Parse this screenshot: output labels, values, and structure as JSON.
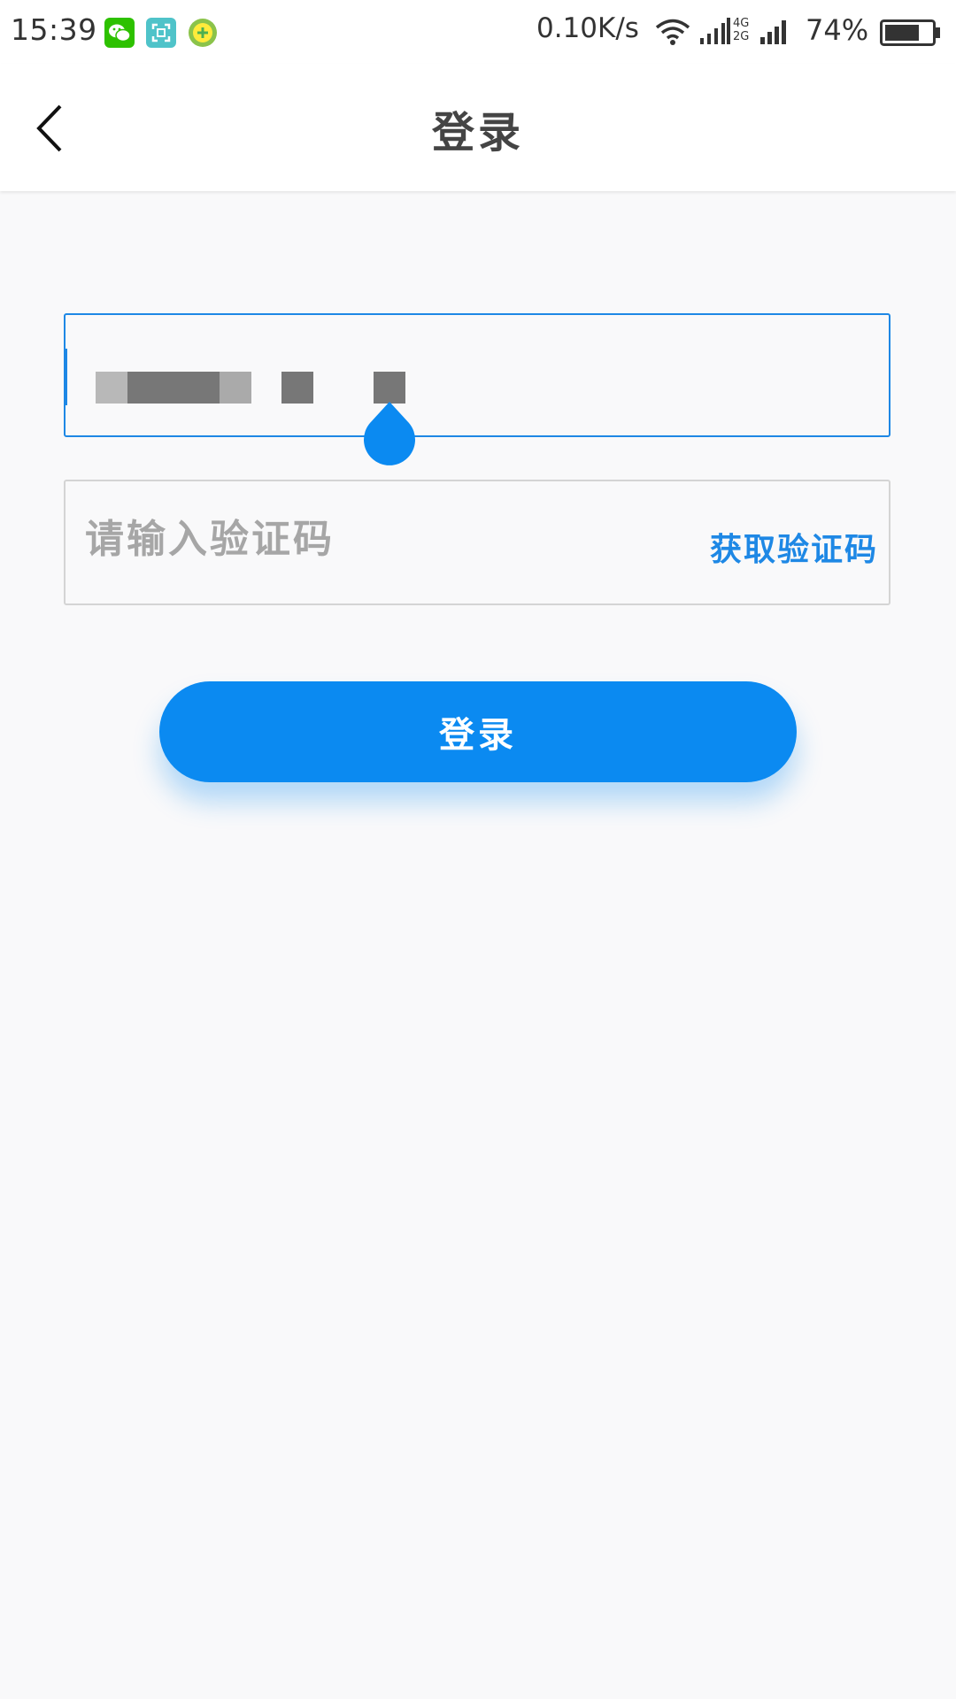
{
  "status_bar": {
    "time": "15:39",
    "net_speed": "0.10K/s",
    "network_top": "4G",
    "network_bottom": "2G",
    "battery_percent": "74%",
    "battery_level": 0.74,
    "app_icons": [
      "wechat-icon",
      "scanner-icon",
      "security-app-icon"
    ]
  },
  "header": {
    "title": "登录",
    "back_icon": "chevron-left-icon"
  },
  "form": {
    "phone": {
      "value": "",
      "masked": true,
      "focused": true
    },
    "code": {
      "placeholder": "请输入验证码",
      "value": ""
    },
    "get_code_label": "获取验证码",
    "submit_label": "登录"
  },
  "colors": {
    "accent": "#0b8af1",
    "focus_border": "#1e88e5",
    "border": "#d4d4d4",
    "placeholder": "#a6a6a6",
    "title": "#444444",
    "background": "#f9f9fa"
  }
}
